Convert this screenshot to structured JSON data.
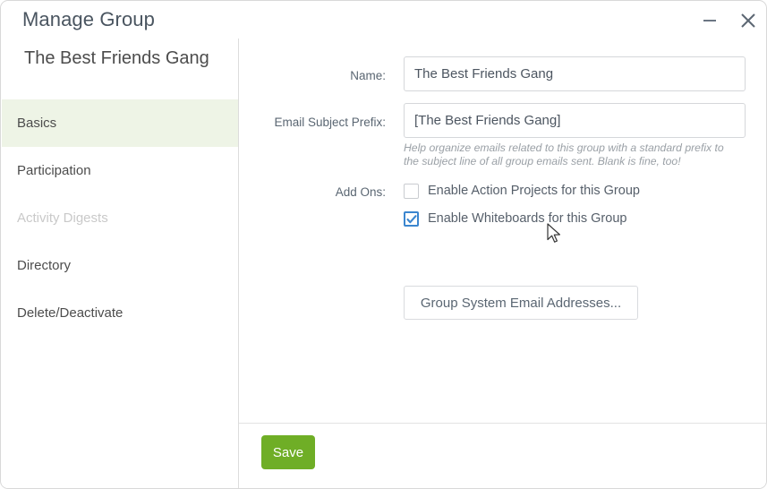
{
  "window": {
    "title": "Manage Group",
    "minimize_icon": "minimize-icon",
    "close_icon": "close-icon",
    "accent_green": "#6fae26",
    "active_nav_bg": "#eef4e6",
    "checkbox_blue": "#3b86cf"
  },
  "sidebar": {
    "group_name": "The Best Friends Gang",
    "items": [
      {
        "label": "Basics",
        "state": "active"
      },
      {
        "label": "Participation",
        "state": "normal"
      },
      {
        "label": "Activity Digests",
        "state": "disabled"
      },
      {
        "label": "Directory",
        "state": "normal"
      },
      {
        "label": "Delete/Deactivate",
        "state": "normal"
      }
    ]
  },
  "form": {
    "name": {
      "label": "Name:",
      "value": "The Best Friends Gang",
      "placeholder": "Name"
    },
    "email_subject_prefix": {
      "label": "Email Subject Prefix:",
      "value": "[The Best Friends Gang]",
      "placeholder": "Email Subject Prefix",
      "helper": "Help organize emails related to this group with a standard prefix to the subject line of all group emails sent. Blank is fine, too!"
    },
    "add_ons": {
      "label": "Add Ons:",
      "options": [
        {
          "label": "Enable Action Projects for this Group",
          "checked": false
        },
        {
          "label": "Enable Whiteboards for this Group",
          "checked": true
        }
      ]
    },
    "system_email_button": "Group System Email Addresses..."
  },
  "footer": {
    "save_label": "Save"
  }
}
